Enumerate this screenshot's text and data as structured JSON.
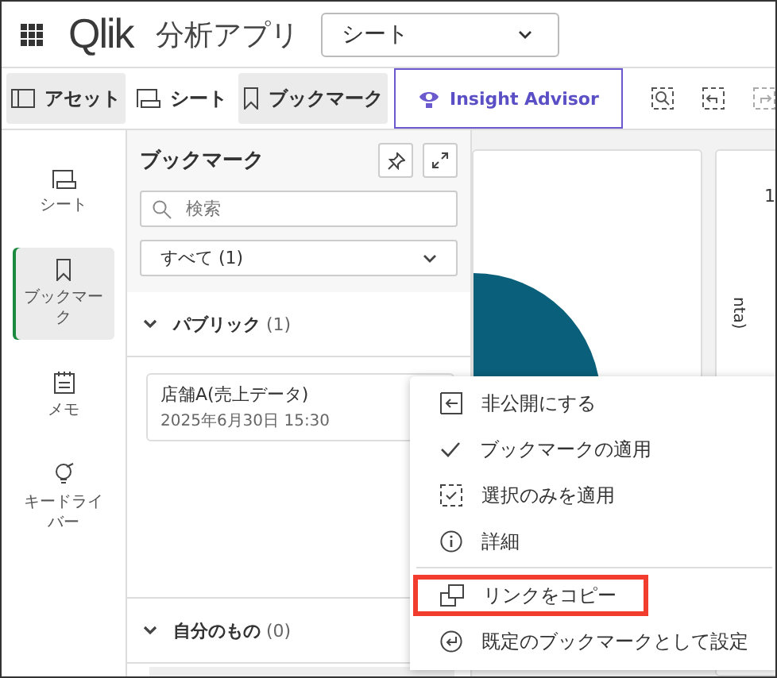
{
  "header": {
    "logo": "Qlik",
    "app_name": "分析アプリ",
    "sheet_dropdown": {
      "value": "シート"
    }
  },
  "toolbar": {
    "tabs": [
      {
        "label": "アセット",
        "selected": true
      },
      {
        "label": "シート",
        "selected": false
      },
      {
        "label": "ブックマーク",
        "selected": true
      }
    ],
    "insight_button": "Insight Advisor"
  },
  "rail": [
    {
      "label": "シート",
      "selected": false
    },
    {
      "label": "ブックマーク",
      "selected": true
    },
    {
      "label": "メモ",
      "selected": false
    },
    {
      "label": "キードライバー",
      "selected": false
    }
  ],
  "panel": {
    "title": "ブックマーク",
    "search": {
      "placeholder": "検索"
    },
    "filter": {
      "value": "すべて (1)"
    },
    "sections": [
      {
        "label": "パブリック",
        "count": "(1)",
        "expanded": true,
        "bookmarks": [
          {
            "name": "店舗A(売上データ)",
            "date": "2025年6月30日 15:30"
          }
        ]
      },
      {
        "label": "自分のもの",
        "count": "(0)",
        "expanded": true
      }
    ]
  },
  "canvas": {
    "chart_2": {
      "value_label": "1",
      "axis_label": "nta)"
    }
  },
  "context_menu": [
    {
      "label": "非公開にする",
      "highlighted": false,
      "divider_before": false
    },
    {
      "label": "ブックマークの適用",
      "highlighted": false,
      "divider_before": false
    },
    {
      "label": "選択のみを適用",
      "highlighted": false,
      "divider_before": false
    },
    {
      "label": "詳細",
      "highlighted": false,
      "divider_before": false
    },
    {
      "label": "リンクをコピー",
      "highlighted": true,
      "divider_before": true
    },
    {
      "label": "既定のブックマークとして設定",
      "highlighted": false,
      "divider_before": false
    }
  ]
}
